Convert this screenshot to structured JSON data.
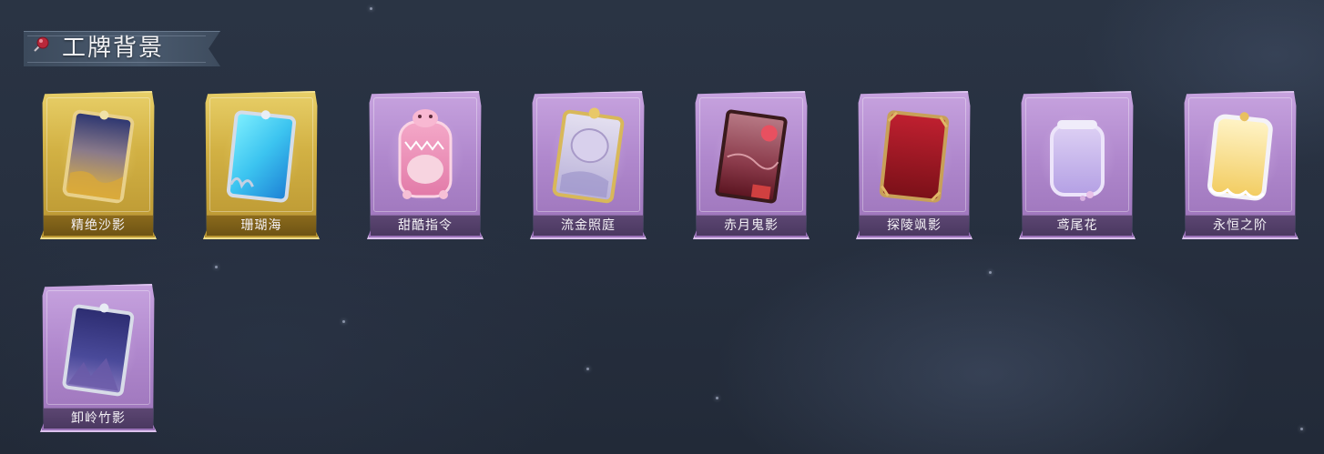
{
  "section": {
    "title": "工牌背景",
    "pin_icon": "pushpin-icon"
  },
  "cards": [
    {
      "label": "精绝沙影",
      "rarity": "gold",
      "art_icon": "sand-frame-card-icon"
    },
    {
      "label": "珊瑚海",
      "rarity": "gold",
      "art_icon": "coral-frame-card-icon"
    },
    {
      "label": "甜酷指令",
      "rarity": "purple",
      "art_icon": "pink-monster-card-icon"
    },
    {
      "label": "流金照庭",
      "rarity": "purple",
      "art_icon": "gilded-frame-card-icon"
    },
    {
      "label": "赤月鬼影",
      "rarity": "purple",
      "art_icon": "red-moon-card-icon"
    },
    {
      "label": "探陵飒影",
      "rarity": "purple",
      "art_icon": "crimson-card-icon"
    },
    {
      "label": "鸢尾花",
      "rarity": "purple",
      "art_icon": "iris-card-icon"
    },
    {
      "label": "永恒之阶",
      "rarity": "purple",
      "art_icon": "golden-glow-card-icon"
    },
    {
      "label": "卸岭竹影",
      "rarity": "purple",
      "art_icon": "bamboo-night-card-icon"
    }
  ],
  "colors": {
    "gold_frame": "#d2b144",
    "purple_frame": "#b088cd",
    "background": "#273040"
  }
}
